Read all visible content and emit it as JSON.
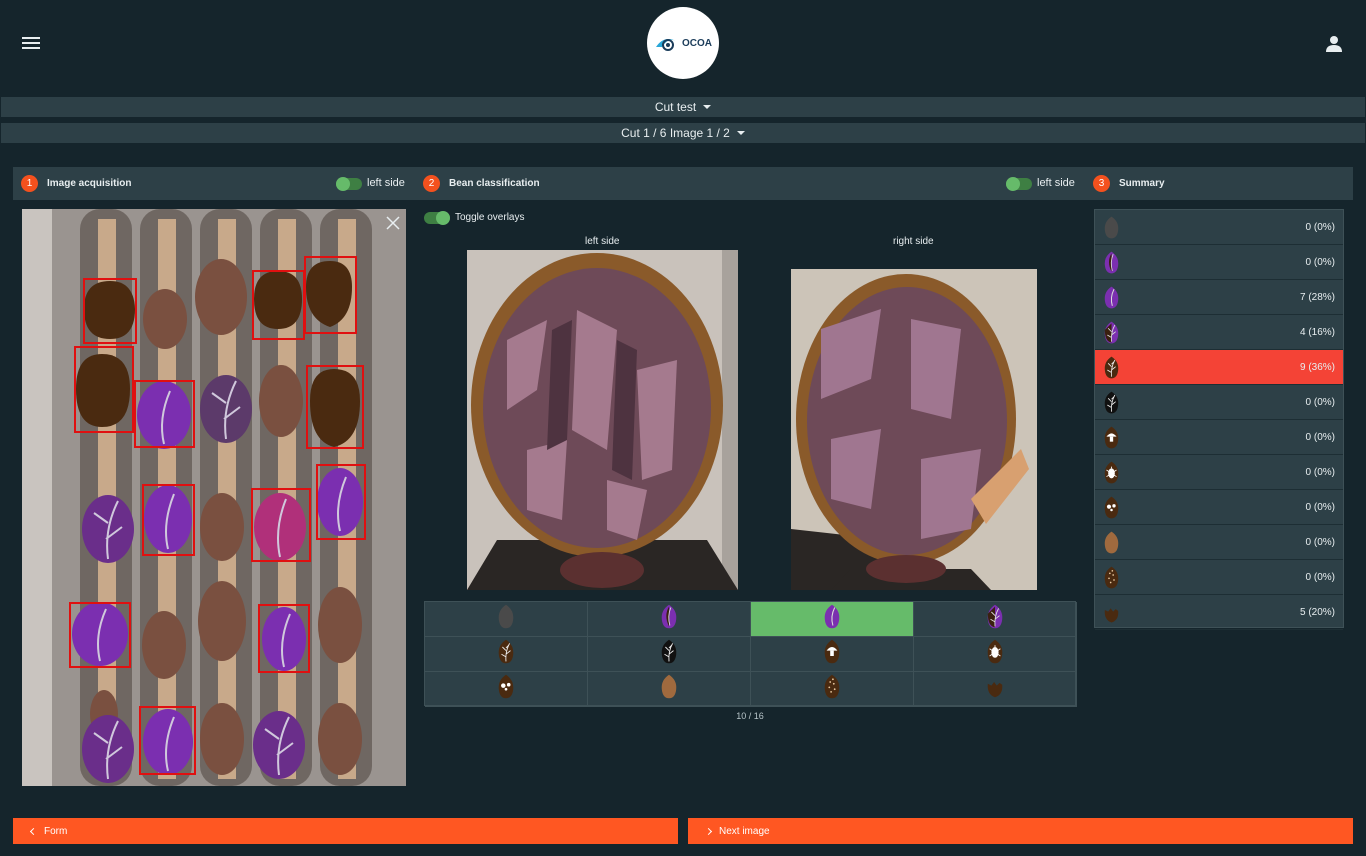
{
  "header": {
    "logo_text": "OCOA"
  },
  "test_selector": {
    "label": "Cut test"
  },
  "cut_selector": {
    "label": "Cut 1 / 6 Image 1 / 2"
  },
  "steps": [
    {
      "num": "1",
      "label": "Image acquisition",
      "toggle_label": "left side"
    },
    {
      "num": "2",
      "label": "Bean classification",
      "toggle_label": "left side"
    },
    {
      "num": "3",
      "label": "Summary"
    }
  ],
  "overlay_toggle": {
    "label": "Toggle overlays"
  },
  "sides": {
    "left": "left side",
    "right": "right side"
  },
  "classification": {
    "selected_index": 2,
    "icons": [
      "slaty-bean-icon",
      "slightly-purple-bean-icon",
      "purple-bean-icon",
      "purple-brown-bean-icon",
      "brown-bean-icon",
      "black-bean-icon",
      "mouldy-bean-icon",
      "insect-bean-icon",
      "germinated-bean-icon",
      "flat-bean-icon",
      "spotted-bean-icon",
      "broken-bean-icon"
    ],
    "counter": "10 / 16"
  },
  "summary": [
    {
      "icon": "slaty-bean-icon",
      "value": "0 (0%)"
    },
    {
      "icon": "slightly-purple-bean-icon",
      "value": "0 (0%)"
    },
    {
      "icon": "purple-bean-icon",
      "value": "7 (28%)"
    },
    {
      "icon": "purple-brown-bean-icon",
      "value": "4 (16%)"
    },
    {
      "icon": "brown-bean-icon",
      "value": "9 (36%)"
    },
    {
      "icon": "black-bean-icon",
      "value": "0 (0%)"
    },
    {
      "icon": "mouldy-bean-icon",
      "value": "0 (0%)"
    },
    {
      "icon": "insect-bean-icon",
      "value": "0 (0%)"
    },
    {
      "icon": "germinated-bean-icon",
      "value": "0 (0%)"
    },
    {
      "icon": "flat-bean-icon",
      "value": "0 (0%)"
    },
    {
      "icon": "spotted-bean-icon",
      "value": "0 (0%)"
    },
    {
      "icon": "broken-bean-icon",
      "value": "5 (20%)"
    }
  ],
  "summary_highlight_index": 4,
  "buttons": {
    "back": "Form",
    "next": "Next image"
  },
  "colors": {
    "accent": "#ff5722",
    "selected": "#66bb6a",
    "highlight": "#f44336",
    "panel": "#2d4047",
    "background": "#15252c"
  }
}
